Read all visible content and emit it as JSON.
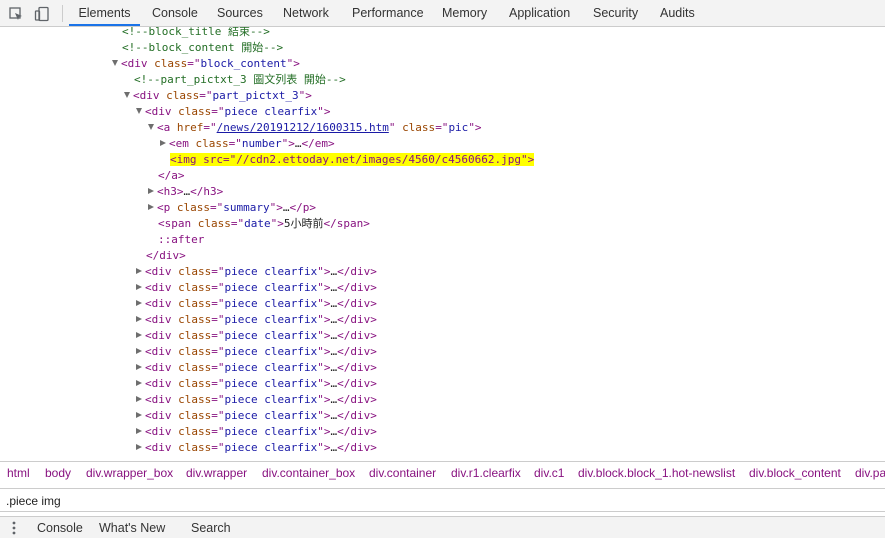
{
  "toolbar": {
    "icons": [
      "inspect-element-icon",
      "device-toolbar-icon"
    ],
    "tabs": [
      "Elements",
      "Console",
      "Sources",
      "Network",
      "Performance",
      "Memory",
      "Application",
      "Security",
      "Audits"
    ],
    "active_tab": "Elements"
  },
  "tree": {
    "l1": "<!--block_title 結束-->",
    "l2": "<!--block_content 開始-->",
    "l3_tag": "div",
    "l3_attr": "class",
    "l3_val": "block_content",
    "l4": "<!--part_pictxt_3 圖文列表 開始-->",
    "l5_tag": "div",
    "l5_attr": "class",
    "l5_val": "part_pictxt_3",
    "l6_tag": "div",
    "l6_attr": "class",
    "l6_val": "piece clearfix",
    "l7_tag": "a",
    "l7_attr1": "href",
    "l7_val1": "/news/20191212/1600315.htm",
    "l7_attr2": "class",
    "l7_val2": "pic",
    "l8_tag": "em",
    "l8_attr": "class",
    "l8_val": "number",
    "l9": "<img src=\"//cdn2.ettoday.net/images/4560/c4560662.jpg\">",
    "l10": "</a>",
    "l11_tag": "h3",
    "l12_tag": "p",
    "l12_attr": "class",
    "l12_val": "summary",
    "l13_tag": "span",
    "l13_attr": "class",
    "l13_val": "date",
    "l13_text": "5小時前",
    "l14": "::after",
    "l15": "</div>",
    "ellipsis": "…",
    "collapsed_rows": [
      {
        "tag": "div",
        "attr": "class",
        "val": "piece clearfix"
      },
      {
        "tag": "div",
        "attr": "class",
        "val": "piece clearfix"
      },
      {
        "tag": "div",
        "attr": "class",
        "val": "piece clearfix"
      },
      {
        "tag": "div",
        "attr": "class",
        "val": "piece clearfix"
      },
      {
        "tag": "div",
        "attr": "class",
        "val": "piece clearfix"
      },
      {
        "tag": "div",
        "attr": "class",
        "val": "piece clearfix"
      },
      {
        "tag": "div",
        "attr": "class",
        "val": "piece clearfix"
      },
      {
        "tag": "div",
        "attr": "class",
        "val": "piece clearfix"
      },
      {
        "tag": "div",
        "attr": "class",
        "val": "piece clearfix"
      },
      {
        "tag": "div",
        "attr": "class",
        "val": "piece clearfix"
      },
      {
        "tag": "div",
        "attr": "class",
        "val": "piece clearfix"
      },
      {
        "tag": "div",
        "attr": "class",
        "val": "piece clearfix"
      }
    ]
  },
  "breadcrumb": [
    "html",
    "body",
    "div.wrapper_box",
    "div.wrapper",
    "div.container_box",
    "div.container",
    "div.r1.clearfix",
    "div.c1",
    "div.block.block_1.hot-newslist",
    "div.block_content",
    "div.pa"
  ],
  "search": {
    "value": ".piece img"
  },
  "drawer": {
    "tabs": [
      "Console",
      "What's New",
      "Search"
    ]
  },
  "colors": {
    "tag": "#881280",
    "attr_name": "#994500",
    "attr_value": "#1a1aa6",
    "comment": "#236e25",
    "highlight": "#ffff00",
    "active_tab": "#1a73e8"
  }
}
